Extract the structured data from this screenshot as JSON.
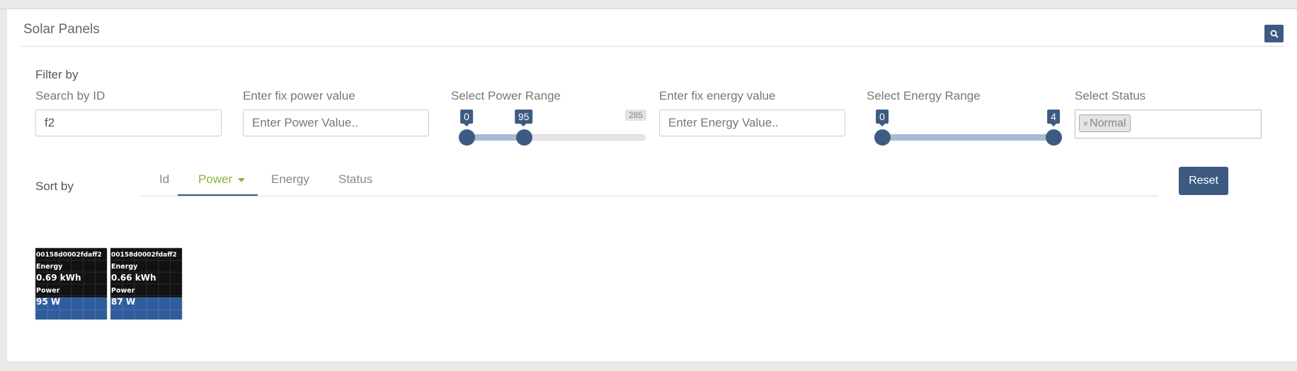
{
  "header": {
    "title": "Solar Panels",
    "search_icon": "search-icon"
  },
  "filters": {
    "title": "Filter by",
    "search_id": {
      "label": "Search by ID",
      "value": "f2"
    },
    "fix_power": {
      "label": "Enter fix power value",
      "placeholder": "Enter Power Value.."
    },
    "power_range": {
      "label": "Select Power Range",
      "min_label": "0",
      "value_label": "95",
      "max_label": "285",
      "min": 0,
      "max": 285,
      "low": 0,
      "high": 95
    },
    "fix_energy": {
      "label": "Enter fix energy value",
      "placeholder": "Enter Energy Value.."
    },
    "energy_range": {
      "label": "Select Energy Range",
      "min_label": "0",
      "max_label": "4",
      "min": 0,
      "max": 4,
      "low": 0,
      "high": 4
    },
    "status": {
      "label": "Select Status",
      "selected": [
        "Normal"
      ],
      "remove_glyph": "×"
    }
  },
  "sort": {
    "label": "Sort by",
    "tabs": [
      "Id",
      "Power",
      "Energy",
      "Status"
    ],
    "active": "Power"
  },
  "reset_label": "Reset",
  "panels": [
    {
      "id": "00158d0002fdaff2",
      "energy_label": "Energy",
      "energy": "0.69 kWh",
      "power_label": "Power",
      "power": "95 W",
      "level": 0.31
    },
    {
      "id": "00158d0002fdaff2",
      "energy_label": "Energy",
      "energy": "0.66 kWh",
      "power_label": "Power",
      "power": "87 W",
      "level": 0.31
    }
  ],
  "colors": {
    "accent": "#3c5a82",
    "active_tab": "#8db33a",
    "panel_fill": "#2f5d9c"
  }
}
